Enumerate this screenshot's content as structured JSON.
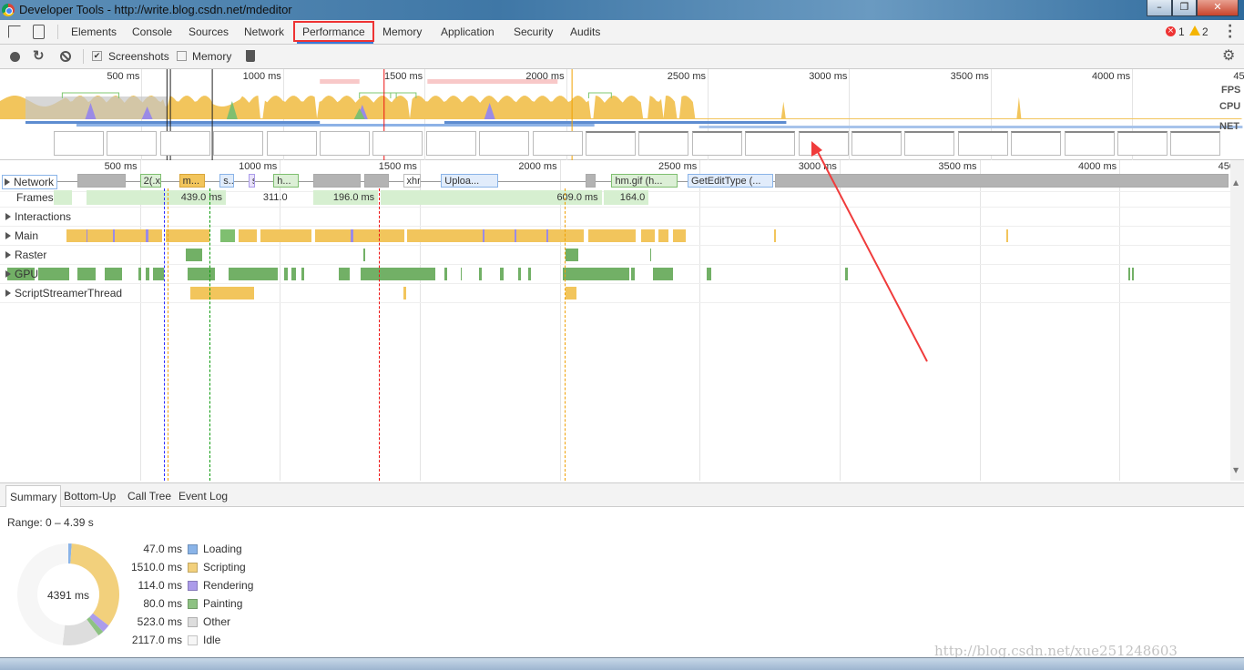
{
  "window": {
    "title": "Developer Tools - http://write.blog.csdn.net/mdeditor",
    "controls": [
      "–",
      "❐",
      "✕"
    ]
  },
  "tabs": [
    {
      "label": "Elements"
    },
    {
      "label": "Console"
    },
    {
      "label": "Sources"
    },
    {
      "label": "Network"
    },
    {
      "label": "Performance",
      "selected": true,
      "highlighted": true
    },
    {
      "label": "Memory"
    },
    {
      "label": "Application"
    },
    {
      "label": "Security"
    },
    {
      "label": "Audits"
    }
  ],
  "status": {
    "errors": "1",
    "warnings": "2"
  },
  "toolbar": {
    "screenshots_label": "Screenshots",
    "screenshots_checked": true,
    "memory_label": "Memory",
    "memory_checked": false
  },
  "overview": {
    "ticks": [
      "500 ms",
      "1000 ms",
      "1500 ms",
      "2000 ms",
      "2500 ms",
      "3000 ms",
      "3500 ms",
      "4000 ms",
      "4500 ms"
    ],
    "labels": {
      "fps": "FPS",
      "cpu": "CPU",
      "net": "NET"
    }
  },
  "ruler": {
    "ticks": [
      "500 ms",
      "1000 ms",
      "1500 ms",
      "2000 ms",
      "2500 ms",
      "3000 ms",
      "3500 ms",
      "4000 ms",
      "4500 ms"
    ]
  },
  "tracks": [
    {
      "label": "Network",
      "expandable": true
    },
    {
      "label": "Frames",
      "expandable": false
    },
    {
      "label": "Interactions",
      "expandable": true
    },
    {
      "label": "Main",
      "expandable": true
    },
    {
      "label": "Raster",
      "expandable": true
    },
    {
      "label": "GPU",
      "expandable": true
    },
    {
      "label": "ScriptStreamerThread",
      "expandable": true
    }
  ],
  "network": [
    {
      "label": "",
      "start": 275,
      "end": 450,
      "kind": "grey"
    },
    {
      "label": "2(.x",
      "start": 500,
      "end": 575,
      "kind": "green"
    },
    {
      "label": "m...",
      "start": 640,
      "end": 732,
      "kind": "yellow"
    },
    {
      "label": "s...",
      "start": 785,
      "end": 835,
      "kind": "blue"
    },
    {
      "label": "s",
      "start": 888,
      "end": 912,
      "kind": "purple"
    },
    {
      "label": "h...",
      "start": 977,
      "end": 1068,
      "kind": "green"
    },
    {
      "label": "",
      "start": 1120,
      "end": 1290,
      "kind": "grey"
    },
    {
      "label": "",
      "start": 1303,
      "end": 1390,
      "kind": "grey"
    },
    {
      "label": "xhr",
      "start": 1440,
      "end": 1505,
      "kind": "white"
    },
    {
      "label": "Uploa...",
      "start": 1576,
      "end": 1780,
      "kind": "blue"
    },
    {
      "label": "",
      "start": 2093,
      "end": 2127,
      "kind": "grey"
    },
    {
      "label": "hm.gif (h...",
      "start": 2185,
      "end": 2420,
      "kind": "green"
    },
    {
      "label": "GetEditType (...",
      "start": 2457,
      "end": 2762,
      "kind": "blue"
    },
    {
      "label": "",
      "start": 2768,
      "end": 4390,
      "kind": "grey"
    }
  ],
  "frames": [
    {
      "label": "",
      "start": 192,
      "end": 257
    },
    {
      "label": "439.0 ms",
      "start": 309,
      "end": 807
    },
    {
      "label": "311.0 ms",
      "start": 885,
      "end": 1040,
      "plain": true
    },
    {
      "label": "196.0 ms",
      "start": 1120,
      "end": 1351
    },
    {
      "label": "609.0 ms",
      "start": 1361,
      "end": 2150
    },
    {
      "label": "164.0 ms",
      "start": 2158,
      "end": 2318
    }
  ],
  "main": {
    "scripting": [
      [
        238,
        580
      ],
      [
        593,
        749
      ],
      [
        853,
        918
      ],
      [
        931,
        1114
      ],
      [
        1127,
        1446
      ],
      [
        1453,
        2085
      ],
      [
        2101,
        2270
      ],
      [
        2290,
        2339
      ],
      [
        2352,
        2388
      ],
      [
        2404,
        2450
      ],
      [
        2766,
        2772
      ],
      [
        3597,
        3601
      ]
    ],
    "painting": [
      [
        788,
        840
      ]
    ],
    "rendering": [
      [
        308,
        314
      ],
      [
        405,
        411
      ],
      [
        520,
        530
      ],
      [
        1253,
        1262
      ],
      [
        1725,
        1732
      ],
      [
        1838,
        1845
      ],
      [
        1952,
        1960
      ]
    ]
  },
  "raster": [
    [
      664,
      723
    ],
    [
      1300,
      1303
    ],
    [
      2020,
      2065
    ],
    [
      2322,
      2326
    ]
  ],
  "gpu": [
    [
      26,
      124
    ],
    [
      137,
      248
    ],
    [
      277,
      342
    ],
    [
      375,
      436
    ],
    [
      495,
      505
    ],
    [
      521,
      534
    ],
    [
      547,
      586
    ],
    [
      671,
      769
    ],
    [
      818,
      993
    ],
    [
      1016,
      1029
    ],
    [
      1042,
      1058
    ],
    [
      1078,
      1087
    ],
    [
      1212,
      1251
    ],
    [
      1290,
      1557
    ],
    [
      1589,
      1599
    ],
    [
      1645,
      1651
    ],
    [
      1713,
      1723
    ],
    [
      1785,
      1798
    ],
    [
      1850,
      1863
    ],
    [
      1889,
      1896
    ],
    [
      2010,
      2248
    ],
    [
      2254,
      2267
    ],
    [
      2332,
      2404
    ],
    [
      2524,
      2541
    ],
    [
      3020,
      3029
    ],
    [
      4033,
      4039
    ],
    [
      4046,
      4052
    ]
  ],
  "script_streamer": [
    [
      681,
      909
    ],
    [
      1443,
      1453
    ],
    [
      2020,
      2059
    ]
  ],
  "markers": [
    {
      "ms": 585,
      "color": "#2a2aff"
    },
    {
      "ms": 600,
      "color": "#f0a000"
    },
    {
      "ms": 749,
      "color": "#0a9a0a"
    },
    {
      "ms": 1355,
      "color": "#e11"
    },
    {
      "ms": 2018,
      "color": "#f0a000"
    }
  ],
  "bottom_tabs": [
    {
      "label": "Summary",
      "selected": true
    },
    {
      "label": "Bottom-Up"
    },
    {
      "label": "Call Tree"
    },
    {
      "label": "Event Log"
    }
  ],
  "summary": {
    "range": "Range: 0 – 4.39 s",
    "total": "4391 ms",
    "items": [
      {
        "value": "47.0 ms",
        "ms": 47,
        "name": "Loading",
        "color": "#8ab4e8"
      },
      {
        "value": "1510.0 ms",
        "ms": 1510,
        "name": "Scripting",
        "color": "#f2d07c"
      },
      {
        "value": "114.0 ms",
        "ms": 114,
        "name": "Rendering",
        "color": "#ac9cea"
      },
      {
        "value": "80.0 ms",
        "ms": 80,
        "name": "Painting",
        "color": "#8ec283"
      },
      {
        "value": "523.0 ms",
        "ms": 523,
        "name": "Other",
        "color": "#dddddd"
      },
      {
        "value": "2117.0 ms",
        "ms": 2117,
        "name": "Idle",
        "color": "#f6f6f6"
      }
    ]
  },
  "watermark": "http://blog.csdn.net/xue251248603"
}
